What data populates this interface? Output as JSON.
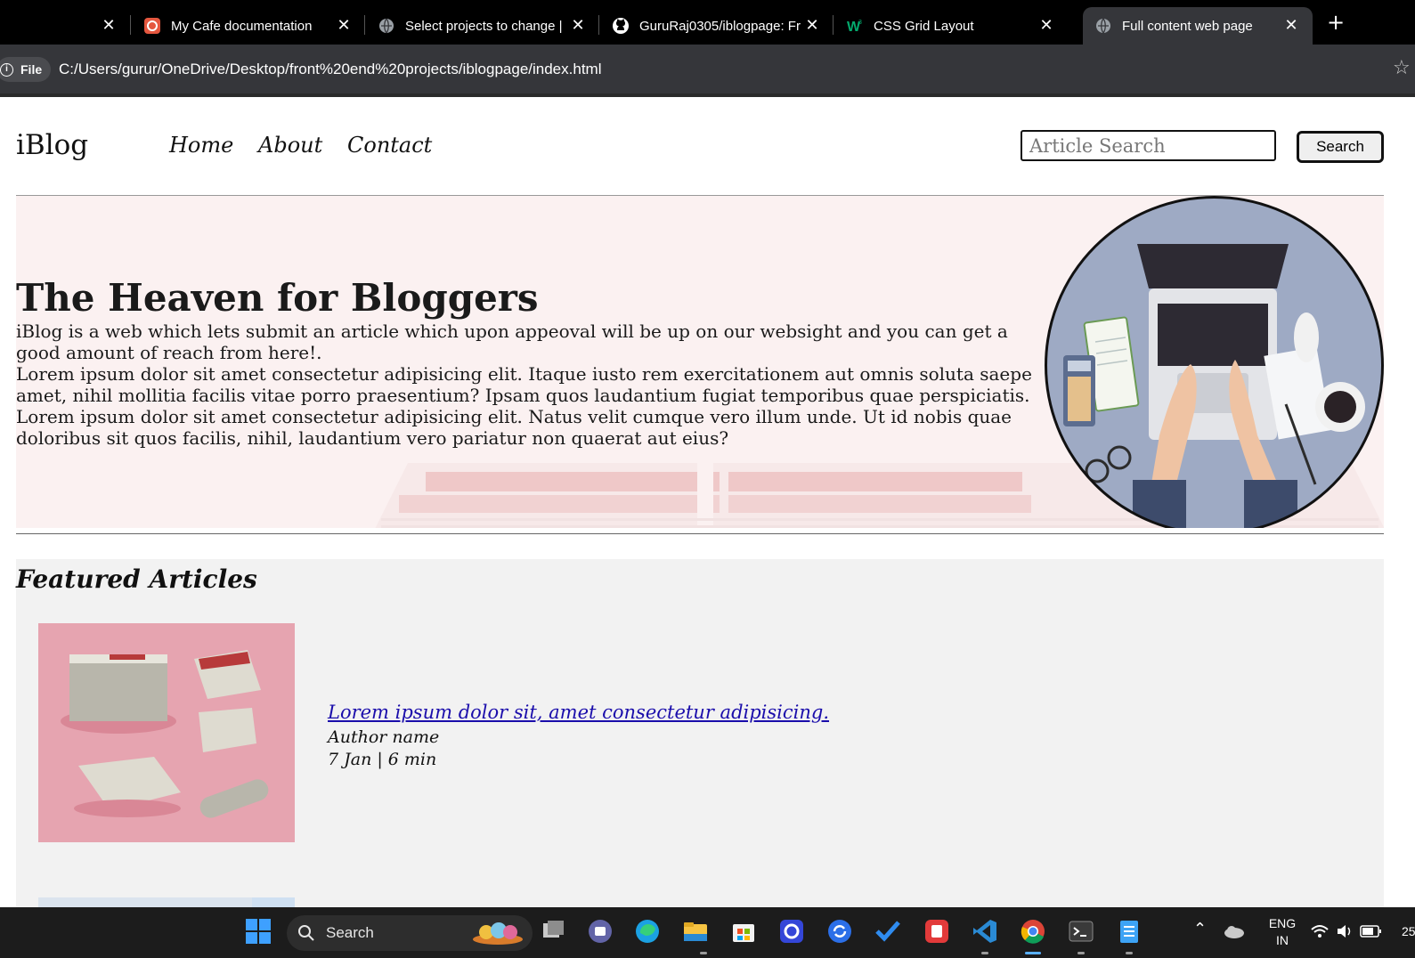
{
  "browser": {
    "tabs": [
      {
        "title": "",
        "favicon": "blank-tab-icon"
      },
      {
        "title": "My Cafe documentation",
        "favicon": "cafe-icon"
      },
      {
        "title": "Select projects to change |",
        "favicon": "globe-icon"
      },
      {
        "title": "GuruRaj0305/iblogpage: Fr",
        "favicon": "github-icon"
      },
      {
        "title": "CSS Grid Layout",
        "favicon": "w3schools-icon"
      },
      {
        "title": "Full content web page",
        "favicon": "globe-icon",
        "active": true
      }
    ],
    "new_tab": "+",
    "file_chip": "File",
    "url": "C:/Users/gurur/OneDrive/Desktop/front%20end%20projects/iblogpage/index.html"
  },
  "site": {
    "brand": "iBlog",
    "nav": [
      "Home",
      "About",
      "Contact"
    ],
    "search": {
      "placeholder": "Article Search",
      "button": "Search"
    }
  },
  "hero": {
    "title": "The Heaven for Bloggers",
    "paragraph1": "iBlog is a web which lets submit an article which upon appeoval will be up on our websight and you can get a good amount of reach from here!.",
    "paragraph2": "Lorem ipsum dolor sit amet consectetur adipisicing elit. Itaque iusto rem exercitationem aut omnis soluta saepe amet, nihil mollitia facilis vitae porro praesentium? Ipsam quos laudantium fugiat temporibus quae perspiciatis. Lorem ipsum dolor sit amet consectetur adipisicing elit. Natus velit cumque vero illum unde. Ut id nobis quae doloribus sit quos facilis, nihil, laudantium vero pariatur non quaerat aut eius?"
  },
  "featured": {
    "heading": "Featured Articles",
    "articles": [
      {
        "title": "Lorem ipsum dolor sit, amet consectetur adipisicing.",
        "author": "Author name",
        "meta": "7 Jan | 6 min"
      }
    ]
  },
  "taskbar": {
    "search_label": "Search",
    "apps": [
      "windows-start-icon",
      "task-view-icon",
      "teams-icon",
      "edge-icon",
      "file-explorer-icon",
      "store-icon",
      "app-icon",
      "sync-icon",
      "todo-icon",
      "app-red-icon",
      "vscode-icon",
      "chrome-icon",
      "terminal-icon",
      "notepad-icon"
    ],
    "language_line1": "ENG",
    "language_line2": "IN",
    "clock_partial": "25"
  },
  "colors": {
    "hero_bg": "#fbf1f1",
    "featured_bg": "#f2f2f2",
    "link": "#1a0dab",
    "thumb_pink": "#e6a4b0",
    "hero_img_bg": "#9eaac4"
  }
}
